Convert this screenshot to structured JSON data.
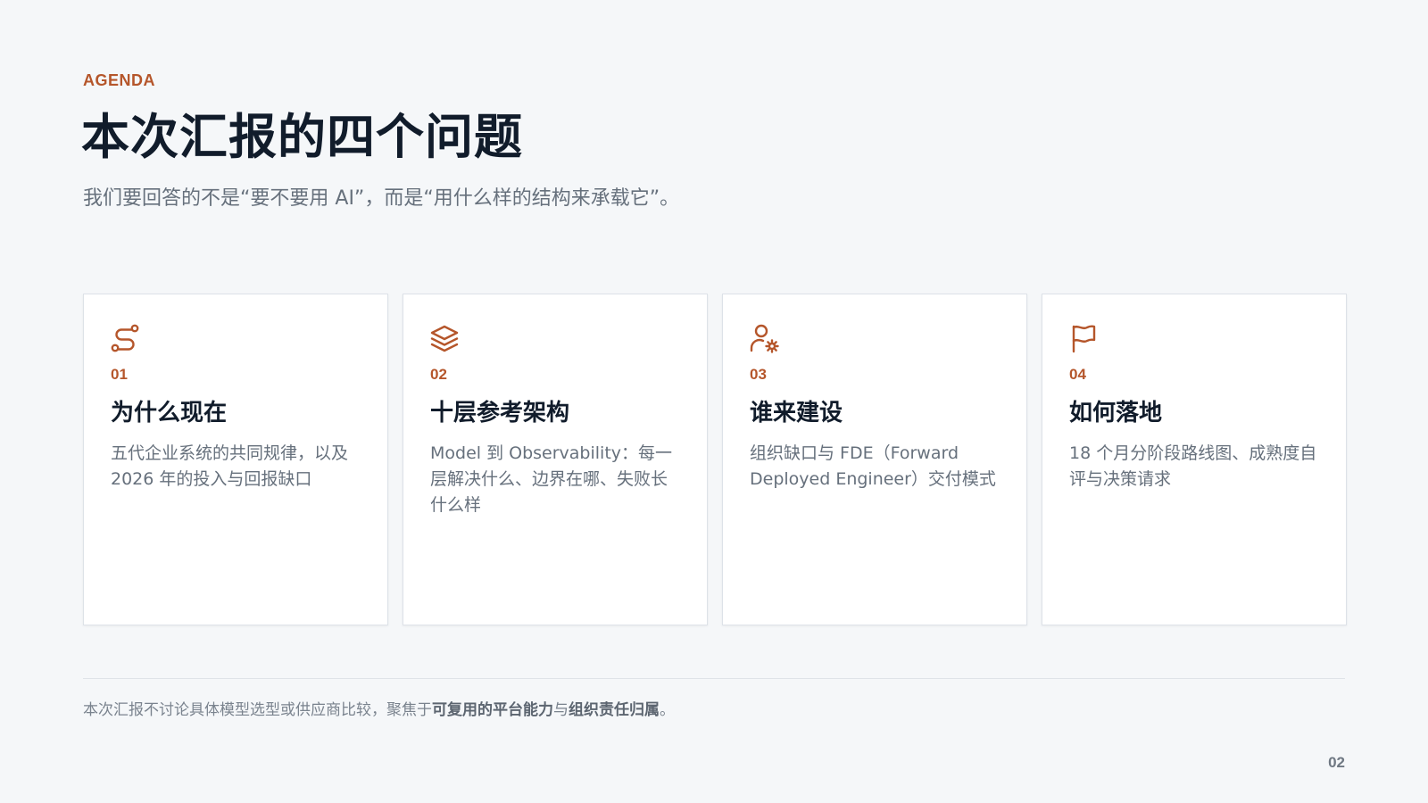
{
  "header": {
    "eyebrow": "AGENDA",
    "title": "本次汇报的四个问题",
    "subtitle": "我们要回答的不是“要不要用 AI”，而是“用什么样的结构来承载它”。"
  },
  "accent_color": "#b5562b",
  "cards": [
    {
      "icon": "route-icon",
      "number": "01",
      "title": "为什么现在",
      "description": "五代企业系统的共同规律，以及 2026 年的投入与回报缺口"
    },
    {
      "icon": "layers-icon",
      "number": "02",
      "title": "十层参考架构",
      "description": "Model 到 Observability：每一层解决什么、边界在哪、失败长什么样"
    },
    {
      "icon": "user-gear-icon",
      "number": "03",
      "title": "谁来建设",
      "description": "组织缺口与 FDE（Forward Deployed Engineer）交付模式"
    },
    {
      "icon": "flag-icon",
      "number": "04",
      "title": "如何落地",
      "description": "18 个月分阶段路线图、成熟度自评与决策请求"
    }
  ],
  "footer": {
    "note_prefix": "本次汇报不讨论具体模型选型或供应商比较，聚焦于",
    "note_emphasis_1": "可复用的平台能力",
    "note_connector": "与",
    "note_emphasis_2": "组织责任归属",
    "note_suffix": "。",
    "page_number": "02"
  }
}
